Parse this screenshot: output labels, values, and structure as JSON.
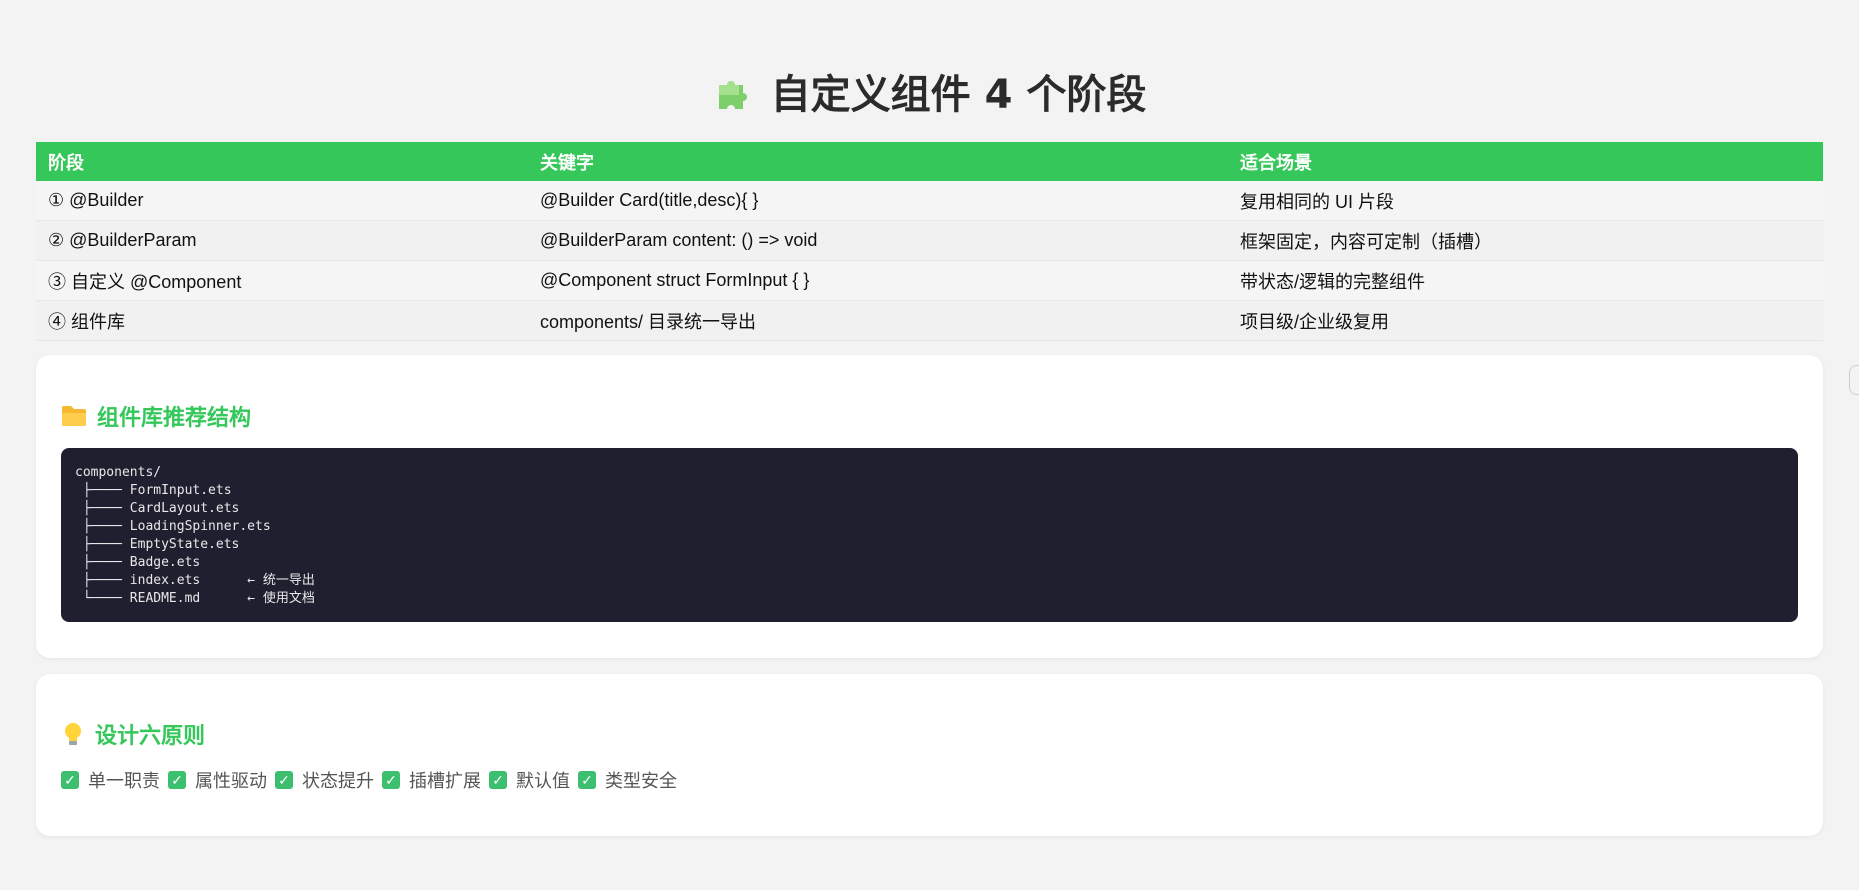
{
  "page": {
    "title": "自定义组件 4 个阶段",
    "title_icon": "puzzle-icon"
  },
  "stages_table": {
    "headers": [
      "阶段",
      "关键字",
      "适合场景"
    ],
    "rows": [
      {
        "stage": "① @Builder",
        "keyword": "@Builder Card(title,desc){ }",
        "scene": "复用相同的 UI 片段"
      },
      {
        "stage": "② @BuilderParam",
        "keyword": "@BuilderParam content: () => void",
        "scene": "框架固定，内容可定制（插槽）"
      },
      {
        "stage": "③ 自定义 @Component",
        "keyword": "@Component struct FormInput { }",
        "scene": "带状态/逻辑的完整组件"
      },
      {
        "stage": "④ 组件库",
        "keyword": "components/ 目录统一导出",
        "scene": "项目级/企业级复用"
      }
    ]
  },
  "structure_card": {
    "heading": "组件库推荐结构",
    "icon": "folder-icon",
    "code": "components/\n ├──── FormInput.ets\n ├──── CardLayout.ets\n ├──── LoadingSpinner.ets\n ├──── EmptyState.ets\n ├──── Badge.ets\n ├──── index.ets      ← 统一导出\n └──── README.md      ← 使用文档"
  },
  "principles_card": {
    "heading": "设计六原则",
    "icon": "lightbulb-icon",
    "items": [
      "单一职责",
      "属性驱动",
      "状态提升",
      "插槽扩展",
      "默认值",
      "类型安全"
    ]
  },
  "colors": {
    "accent": "#35c759",
    "code_bg": "#1f1f30",
    "page_bg": "#f3f3f3"
  }
}
